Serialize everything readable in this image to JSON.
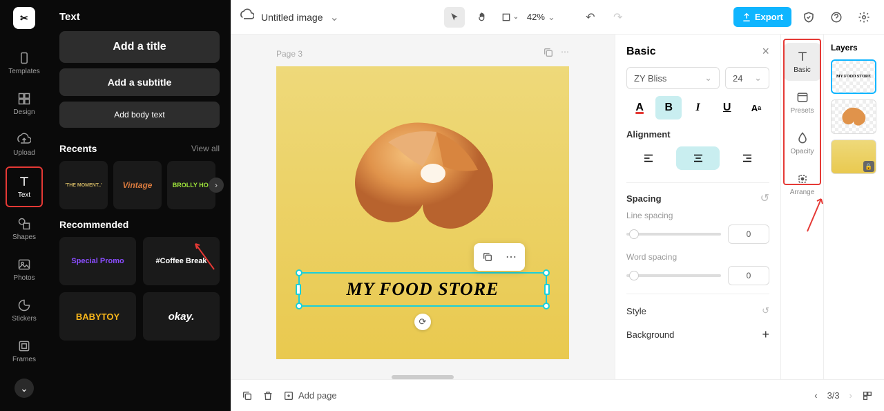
{
  "rail": {
    "templates": "Templates",
    "design": "Design",
    "upload": "Upload",
    "text": "Text",
    "shapes": "Shapes",
    "photos": "Photos",
    "stickers": "Stickers",
    "frames": "Frames"
  },
  "text_panel": {
    "title": "Text",
    "add_title": "Add a title",
    "add_subtitle": "Add a subtitle",
    "add_body": "Add body text",
    "recents": "Recents",
    "view_all": "View all",
    "recommended": "Recommended",
    "recent_items": [
      "'THE MOMENT..'",
      "Vintage",
      "BROLLY HO."
    ],
    "rec_items": [
      "Special Promo",
      "#Coffee Break",
      "BABYTOY",
      "okay."
    ]
  },
  "topbar": {
    "doc_title": "Untitled image",
    "zoom": "42%",
    "export": "Export"
  },
  "canvas": {
    "page_label": "Page 3",
    "text_content": "MY FOOD STORE"
  },
  "basic_panel": {
    "title": "Basic",
    "font": "ZY Bliss",
    "size": "24",
    "alignment": "Alignment",
    "spacing": "Spacing",
    "line_spacing": "Line spacing",
    "word_spacing": "Word spacing",
    "line_val": "0",
    "word_val": "0",
    "style": "Style",
    "background": "Background"
  },
  "prop_tabs": {
    "basic": "Basic",
    "presets": "Presets",
    "opacity": "Opacity",
    "arrange": "Arrange"
  },
  "layers": {
    "title": "Layers",
    "text_thumb": "MY FOOD STORE"
  },
  "bottombar": {
    "add_page": "Add page",
    "page_ind": "3/3"
  }
}
